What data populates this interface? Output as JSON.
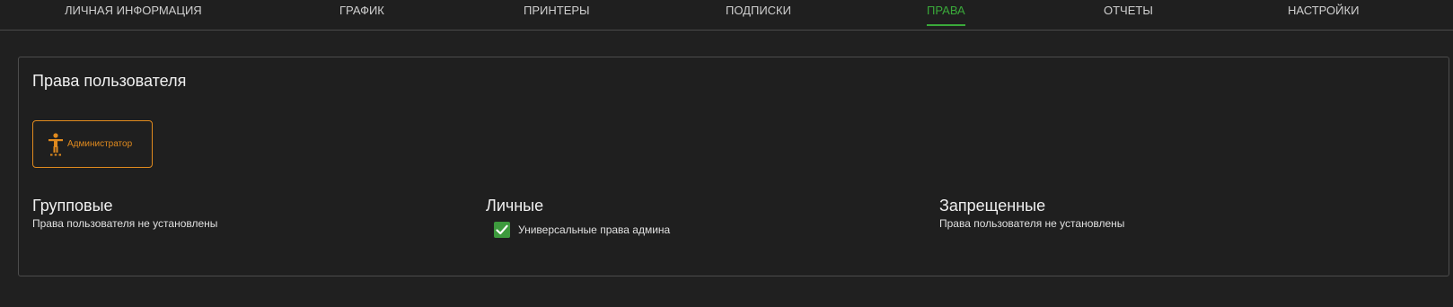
{
  "tabs": [
    {
      "label": "ЛИЧНАЯ ИНФОРМАЦИЯ",
      "active": false
    },
    {
      "label": "ГРАФИК",
      "active": false
    },
    {
      "label": "ПРИНТЕРЫ",
      "active": false
    },
    {
      "label": "ПОДПИСКИ",
      "active": false
    },
    {
      "label": "ПРАВА",
      "active": true
    },
    {
      "label": "ОТЧЕТЫ",
      "active": false
    },
    {
      "label": "НАСТРОЙКИ",
      "active": false
    }
  ],
  "card": {
    "title": "Права пользователя",
    "role": {
      "label": "Администратор",
      "icon": "accessibility-person-icon"
    },
    "sections": {
      "group": {
        "title": "Групповые",
        "text": "Права пользователя не установлены"
      },
      "personal": {
        "title": "Личные",
        "permissions": [
          {
            "label": "Универсальные права админа",
            "checked": true
          }
        ]
      },
      "forbidden": {
        "title": "Запрещенные",
        "text": "Права пользователя не установлены"
      }
    }
  },
  "colors": {
    "background": "#202020",
    "accent_green": "#3aa93a",
    "accent_orange": "#e08a1e",
    "border": "#4c4c4c"
  }
}
